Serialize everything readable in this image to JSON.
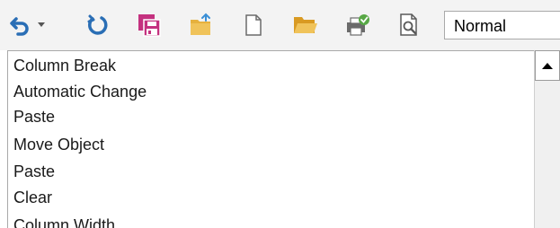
{
  "toolbar": {
    "icons": [
      {
        "name": "undo-icon",
        "color": "#2a6eb5"
      },
      {
        "name": "redo-icon",
        "color": "#2a6eb5"
      },
      {
        "name": "save-all-icon",
        "color": "#c4317f"
      },
      {
        "name": "open-folder-icon",
        "color": "#e6b13e"
      },
      {
        "name": "new-document-icon",
        "color": "#6b6b6b"
      },
      {
        "name": "open-file-icon",
        "color": "#e6b13e"
      },
      {
        "name": "print-check-icon",
        "color": "#58a846"
      },
      {
        "name": "print-preview-icon",
        "color": "#5a5a5a"
      }
    ],
    "style_dropdown": {
      "value": "Normal"
    }
  },
  "undo_list": {
    "items": [
      "Column Break",
      "Automatic Change",
      "Paste",
      "Move Object",
      "Paste",
      "Clear",
      "Column Width"
    ]
  },
  "colors": {
    "toolbar_bg": "#f3f3f3",
    "list_bg": "#ffffff",
    "border": "#a9a9a9"
  }
}
